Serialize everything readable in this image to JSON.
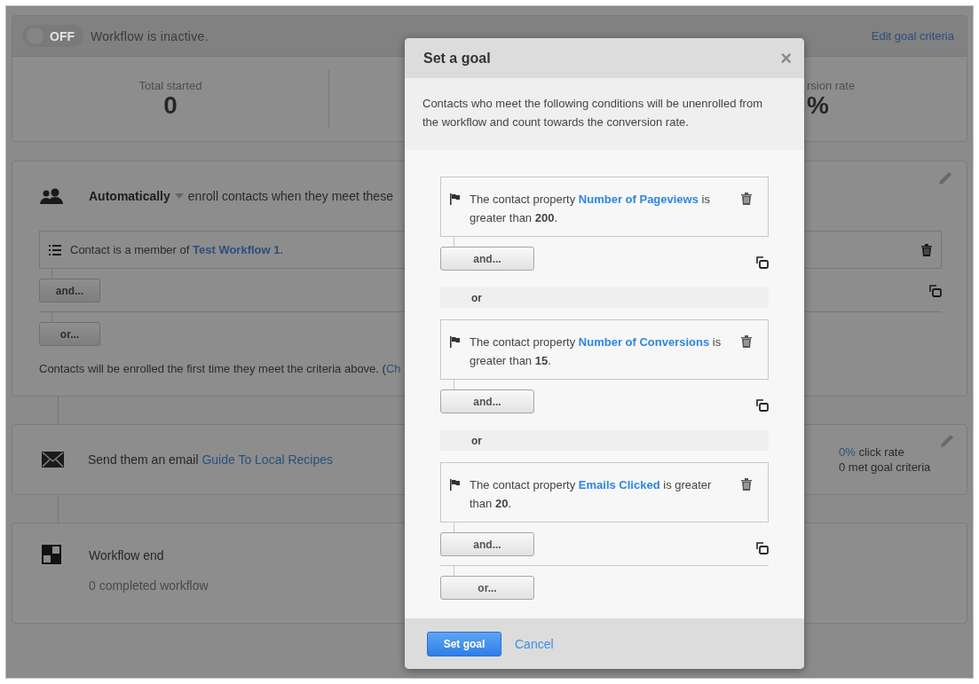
{
  "header": {
    "toggle": {
      "on": false,
      "label": "OFF"
    },
    "status": "Workflow is inactive.",
    "edit_link": "Edit goal criteria"
  },
  "stats": [
    {
      "label": "Total started",
      "value": "0"
    },
    {
      "label": "rsion rate",
      "value": "%"
    }
  ],
  "enrollment": {
    "mode": "Automatically",
    "text": "enroll contacts when they meet these",
    "condition": {
      "text": "Contact is a member of",
      "link": "Test Workflow 1",
      "suffix": "."
    },
    "and_button": "and...",
    "or_button": "or...",
    "note": "Contacts will be enrolled the first time they meet the criteria above. (",
    "note_link": "Ch"
  },
  "steps": [
    {
      "kind": "email",
      "text": "Send them an email",
      "link": "Guide To Local Recipes",
      "rate": "0%",
      "rate_label": "click rate",
      "goal": "0 met goal criteria"
    },
    {
      "kind": "end",
      "title": "Workflow end",
      "subtitle": "0 completed workflow"
    }
  ],
  "dialog": {
    "title": "Set a goal",
    "close": "×",
    "description": "Contacts who meet the following conditions will be unenrolled from the workflow and count towards the conversion rate.",
    "groups": [
      {
        "conditions": [
          {
            "prefix": "The contact property",
            "property": "Number of Pageviews",
            "middle": "is greater than",
            "value": "200",
            "suffix": "."
          }
        ],
        "and_button": "and..."
      },
      {
        "or_label": "or",
        "conditions": [
          {
            "prefix": "The contact property",
            "property": "Number of Conversions",
            "middle": "is greater than",
            "value": "15",
            "suffix": "."
          }
        ],
        "and_button": "and..."
      },
      {
        "or_label": "or",
        "conditions": [
          {
            "prefix": "The contact property",
            "property": "Emails Clicked",
            "middle": "is greater than",
            "value": "20",
            "suffix": "."
          }
        ],
        "and_button": "and..."
      }
    ],
    "or_button": "or...",
    "submit": "Set goal",
    "cancel": "Cancel"
  }
}
